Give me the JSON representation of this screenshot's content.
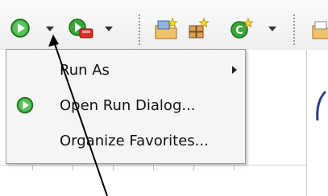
{
  "toolbar": {
    "icons": [
      "run-icon",
      "run-dropdown-icon",
      "debug-icon",
      "debug-dropdown-icon",
      "new-project-icon",
      "new-package-icon",
      "new-class-icon",
      "new-class-dropdown-icon",
      "open-folder-icon"
    ]
  },
  "menu": {
    "items": [
      {
        "label": "Run As",
        "has_submenu": true
      },
      {
        "label": "Open Run Dialog...",
        "icon": "run-icon"
      },
      {
        "label": "Organize Favorites..."
      }
    ]
  },
  "colors": {
    "run_green": "#2e9b2e",
    "menu_bg": "#f5f5f5",
    "menu_border": "#9c9c9c"
  }
}
